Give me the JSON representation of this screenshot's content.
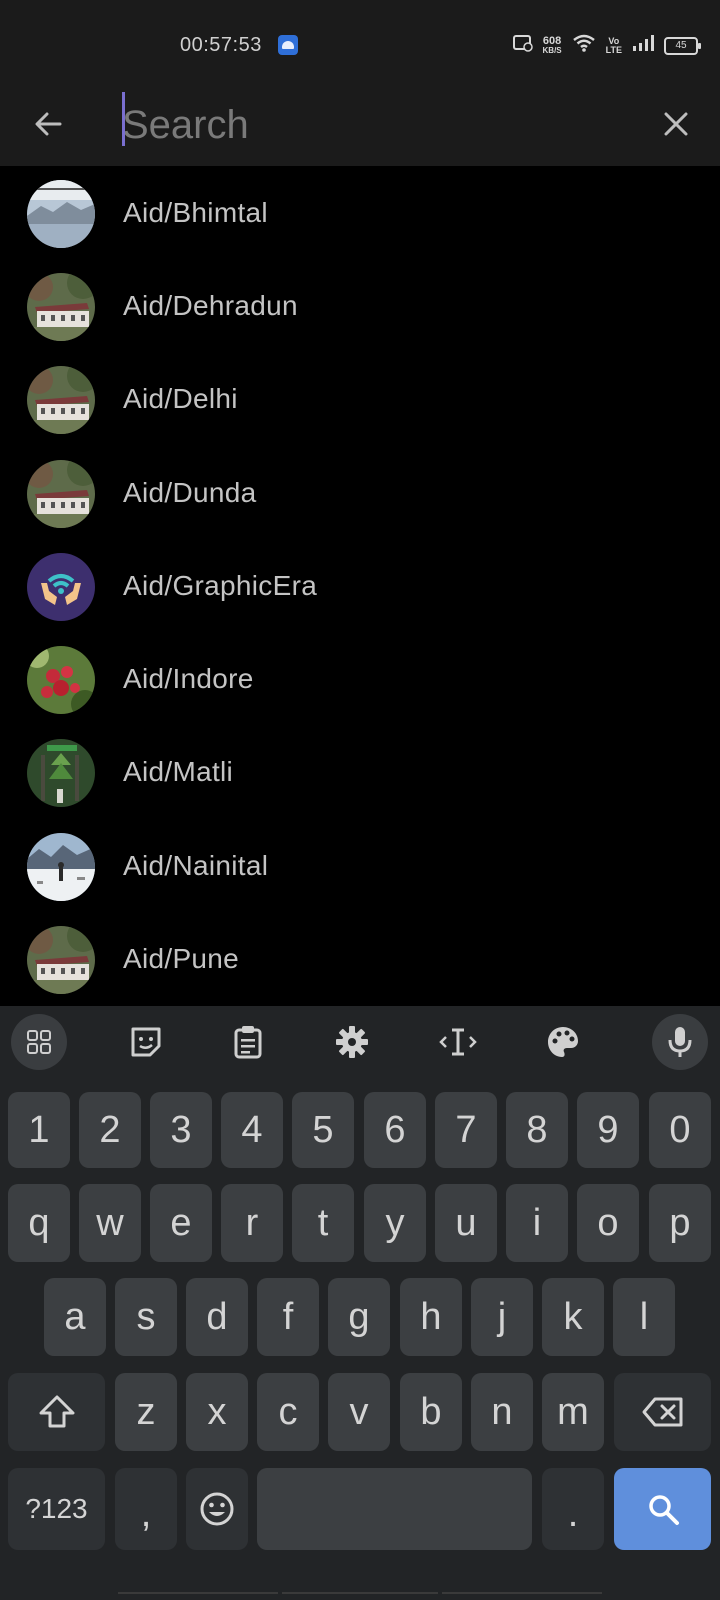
{
  "status_bar": {
    "time": "00:57:53",
    "net_speed_value": "608",
    "net_speed_unit": "KB/S",
    "volte_top": "Vo",
    "volte_bottom": "LTE",
    "battery": "45"
  },
  "search": {
    "placeholder": "Search",
    "value": ""
  },
  "results": [
    {
      "label": "Aid/Bhimtal",
      "avatar": "mountain-lake-photo"
    },
    {
      "label": "Aid/Dehradun",
      "avatar": "building-hill-photo"
    },
    {
      "label": "Aid/Delhi",
      "avatar": "building-hill-photo"
    },
    {
      "label": "Aid/Dunda",
      "avatar": "building-hill-photo"
    },
    {
      "label": "Aid/GraphicEra",
      "avatar": "hands-wifi-logo"
    },
    {
      "label": "Aid/Indore",
      "avatar": "red-berries-photo"
    },
    {
      "label": "Aid/Matli",
      "avatar": "green-forest-photo"
    },
    {
      "label": "Aid/Nainital",
      "avatar": "snow-landscape-photo"
    },
    {
      "label": "Aid/Pune",
      "avatar": "building-hill-photo"
    }
  ],
  "keyboard": {
    "toolbar": [
      "apps-grid-icon",
      "sticker-icon",
      "clipboard-icon",
      "gear-icon",
      "text-cursor-icon",
      "palette-icon",
      "microphone-icon"
    ],
    "rows": [
      [
        "1",
        "2",
        "3",
        "4",
        "5",
        "6",
        "7",
        "8",
        "9",
        "0"
      ],
      [
        "q",
        "w",
        "e",
        "r",
        "t",
        "y",
        "u",
        "i",
        "o",
        "p"
      ],
      [
        "a",
        "s",
        "d",
        "f",
        "g",
        "h",
        "j",
        "k",
        "l"
      ],
      [
        "z",
        "x",
        "c",
        "v",
        "b",
        "n",
        "m"
      ]
    ],
    "symbols_label": "?123",
    "comma_label": ",",
    "period_label": "."
  },
  "colors": {
    "accent": "#5f8fdc",
    "caret": "#7a6fd0"
  }
}
